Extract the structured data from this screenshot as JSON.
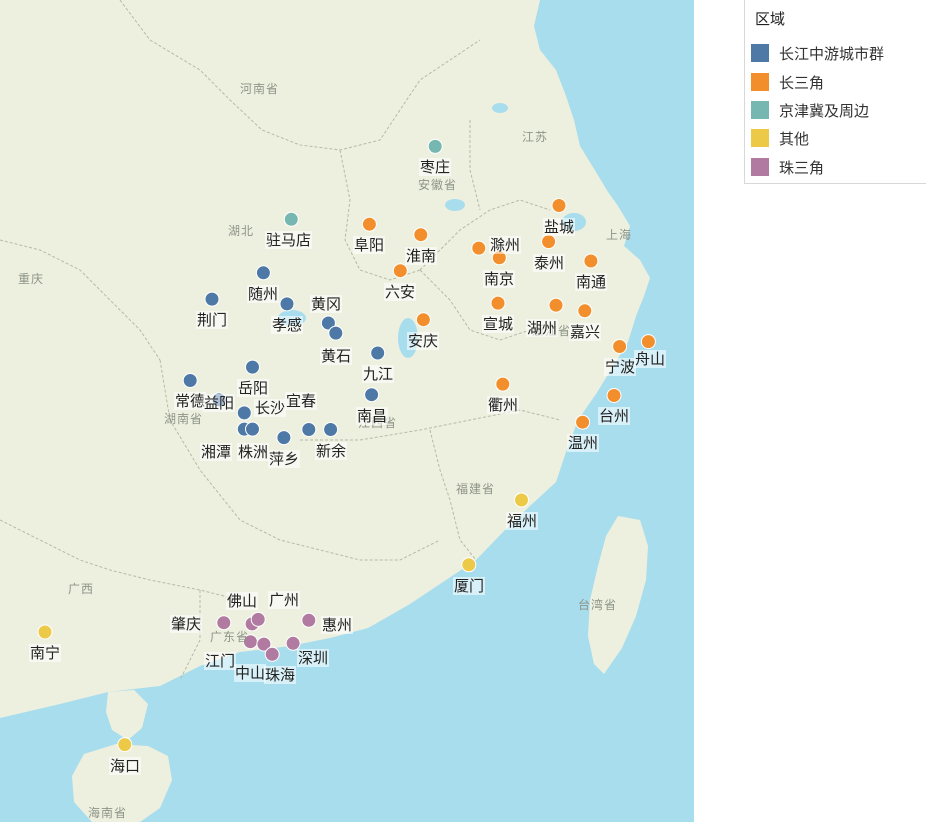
{
  "legend": {
    "title": "区域",
    "items": [
      {
        "label": "长江中游城市群",
        "color": "#4e79a7"
      },
      {
        "label": "长三角",
        "color": "#f28e2b"
      },
      {
        "label": "京津冀及周边",
        "color": "#76b7b2"
      },
      {
        "label": "其他",
        "color": "#edc948"
      },
      {
        "label": "珠三角",
        "color": "#b07aa1"
      }
    ]
  },
  "map": {
    "land_color": "#eef0df",
    "sea_color": "#a8ddee",
    "provinces": [
      "河南省",
      "湖北",
      "重庆",
      "江苏",
      "安徽省",
      "浙江省",
      "上海",
      "湖南省",
      "江西省",
      "福建省",
      "台湾省",
      "广西",
      "广东省",
      "海南省"
    ]
  },
  "cities": [
    {
      "name": "枣庄",
      "region": 2,
      "lon": 117.32,
      "lat": 34.81
    },
    {
      "name": "驻马店",
      "region": 2,
      "lon": 114.02,
      "lat": 33.01
    },
    {
      "name": "阜阳",
      "region": 1,
      "lon": 115.81,
      "lat": 32.89
    },
    {
      "name": "滁州",
      "region": 1,
      "lon": 118.32,
      "lat": 32.3
    },
    {
      "name": "淮南",
      "region": 1,
      "lon": 116.99,
      "lat": 32.63
    },
    {
      "name": "盐城",
      "region": 1,
      "lon": 120.16,
      "lat": 33.35
    },
    {
      "name": "泰州",
      "region": 1,
      "lon": 119.92,
      "lat": 32.46
    },
    {
      "name": "南京",
      "region": 1,
      "lon": 118.79,
      "lat": 32.06
    },
    {
      "name": "南通",
      "region": 1,
      "lon": 120.89,
      "lat": 31.98
    },
    {
      "name": "六安",
      "region": 1,
      "lon": 116.52,
      "lat": 31.74
    },
    {
      "name": "宣城",
      "region": 1,
      "lon": 118.76,
      "lat": 30.94
    },
    {
      "name": "湖州",
      "region": 1,
      "lon": 120.09,
      "lat": 30.89
    },
    {
      "name": "嘉兴",
      "region": 1,
      "lon": 120.75,
      "lat": 30.75
    },
    {
      "name": "安庆",
      "region": 1,
      "lon": 117.05,
      "lat": 30.53
    },
    {
      "name": "宁波",
      "region": 1,
      "lon": 121.55,
      "lat": 29.87
    },
    {
      "name": "舟山",
      "region": 1,
      "lon": 122.21,
      "lat": 29.99
    },
    {
      "name": "衢州",
      "region": 1,
      "lon": 118.87,
      "lat": 28.94
    },
    {
      "name": "台州",
      "region": 1,
      "lon": 121.42,
      "lat": 28.66
    },
    {
      "name": "温州",
      "region": 1,
      "lon": 120.7,
      "lat": 28.0
    },
    {
      "name": "随州",
      "region": 0,
      "lon": 113.38,
      "lat": 31.69
    },
    {
      "name": "荆门",
      "region": 0,
      "lon": 112.2,
      "lat": 31.04
    },
    {
      "name": "孝感",
      "region": 0,
      "lon": 113.92,
      "lat": 30.92
    },
    {
      "name": "黄冈",
      "region": 0,
      "lon": 114.87,
      "lat": 30.45
    },
    {
      "name": "黄石",
      "region": 0,
      "lon": 115.04,
      "lat": 30.2
    },
    {
      "name": "九江",
      "region": 0,
      "lon": 116.0,
      "lat": 29.71
    },
    {
      "name": "岳阳",
      "region": 0,
      "lon": 113.13,
      "lat": 29.36
    },
    {
      "name": "常德",
      "region": 0,
      "lon": 111.7,
      "lat": 29.03
    },
    {
      "name": "益阳",
      "region": 0,
      "lon": 112.36,
      "lat": 28.55
    },
    {
      "name": "南昌",
      "region": 0,
      "lon": 115.86,
      "lat": 28.68
    },
    {
      "name": "长沙",
      "region": 0,
      "lon": 112.94,
      "lat": 28.23
    },
    {
      "name": "宜春",
      "region": 0,
      "lon": 114.42,
      "lat": 27.82
    },
    {
      "name": "湘潭",
      "region": 0,
      "lon": 112.94,
      "lat": 27.83
    },
    {
      "name": "株洲",
      "region": 0,
      "lon": 113.13,
      "lat": 27.83
    },
    {
      "name": "萍乡",
      "region": 0,
      "lon": 113.85,
      "lat": 27.62
    },
    {
      "name": "新余",
      "region": 0,
      "lon": 114.92,
      "lat": 27.82
    },
    {
      "name": "福州",
      "region": 3,
      "lon": 119.3,
      "lat": 26.08
    },
    {
      "name": "厦门",
      "region": 3,
      "lon": 118.09,
      "lat": 24.48
    },
    {
      "name": "南宁",
      "region": 3,
      "lon": 108.37,
      "lat": 22.82
    },
    {
      "name": "海口",
      "region": 3,
      "lon": 110.2,
      "lat": 20.04
    },
    {
      "name": "佛山",
      "region": 4,
      "lon": 113.12,
      "lat": 23.02
    },
    {
      "name": "广州",
      "region": 4,
      "lon": 113.26,
      "lat": 23.13
    },
    {
      "name": "肇庆",
      "region": 4,
      "lon": 112.47,
      "lat": 23.05
    },
    {
      "name": "惠州",
      "region": 4,
      "lon": 114.42,
      "lat": 23.11
    },
    {
      "name": "江门",
      "region": 4,
      "lon": 113.08,
      "lat": 22.58
    },
    {
      "name": "中山",
      "region": 4,
      "lon": 113.39,
      "lat": 22.52
    },
    {
      "name": "深圳",
      "region": 4,
      "lon": 114.06,
      "lat": 22.54
    },
    {
      "name": "珠海",
      "region": 4,
      "lon": 113.58,
      "lat": 22.27
    }
  ]
}
